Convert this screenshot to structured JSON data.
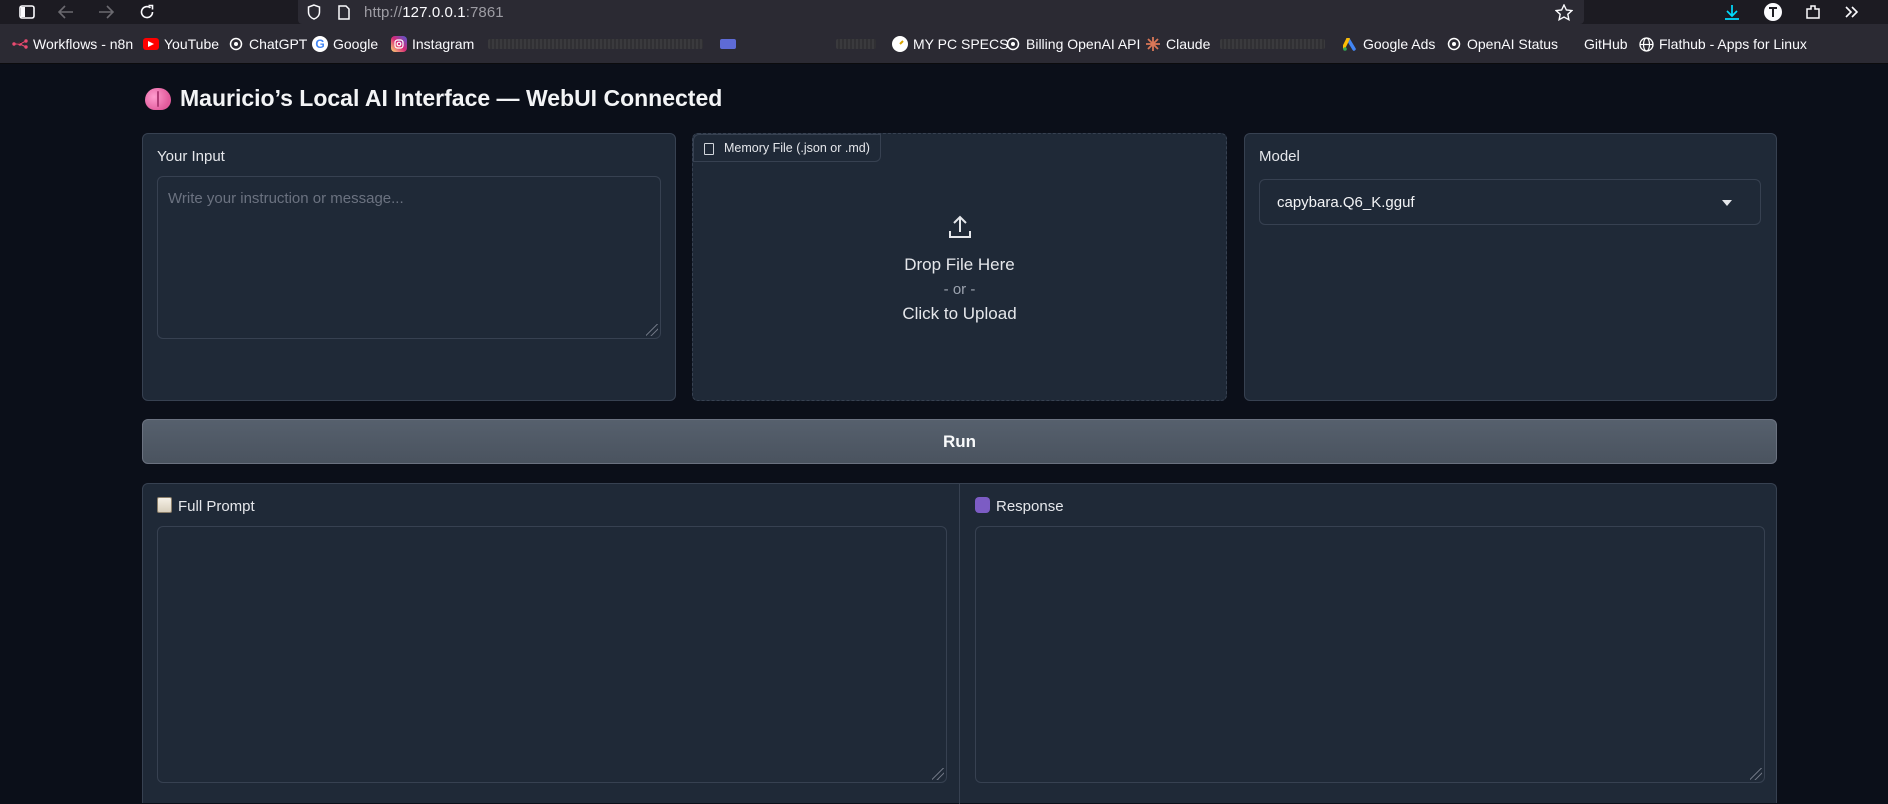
{
  "browser": {
    "url_prefix": "http://",
    "url_host": "127.0.0.1",
    "url_port": ":7861"
  },
  "bookmarks": [
    {
      "label": "Workflows - n8n",
      "icon": "n8n-icon",
      "color": "#ea4b71"
    },
    {
      "label": "YouTube",
      "icon": "youtube-icon",
      "color": "#ff0000"
    },
    {
      "label": "ChatGPT",
      "icon": "openai-icon",
      "color": "#ffffff"
    },
    {
      "label": "Google",
      "icon": "google-icon",
      "color": "#4285f4"
    },
    {
      "label": "Instagram",
      "icon": "instagram-icon",
      "color": "#d62976"
    },
    {
      "label": "MY PC SPECS",
      "icon": "gauge-icon",
      "color": "#f5c542"
    },
    {
      "label": "Billing OpenAI API",
      "icon": "openai-icon",
      "color": "#ffffff"
    },
    {
      "label": "Claude",
      "icon": "claude-icon",
      "color": "#d97757"
    },
    {
      "label": "Google Ads",
      "icon": "google-ads-icon",
      "color": "#4285f4"
    },
    {
      "label": "OpenAI Status",
      "icon": "openai-icon",
      "color": "#ffffff"
    },
    {
      "label": "GitHub",
      "icon": "github-icon",
      "color": "#ffffff"
    },
    {
      "label": "Flathub - Apps for Linux",
      "icon": "globe-icon",
      "color": "#ffffff"
    }
  ],
  "app": {
    "title": "Mauricio’s Local AI Interface — WebUI Connected",
    "input": {
      "label": "Your Input",
      "placeholder": "Write your instruction or message..."
    },
    "upload": {
      "label": "Memory File (.json or .md)",
      "drop_text": "Drop File Here",
      "or_text": "- or -",
      "click_text": "Click to Upload"
    },
    "model": {
      "label": "Model",
      "selected": "capybara.Q6_K.gguf"
    },
    "run_label": "Run",
    "full_prompt_label": "Full Prompt",
    "response_label": "Response"
  }
}
